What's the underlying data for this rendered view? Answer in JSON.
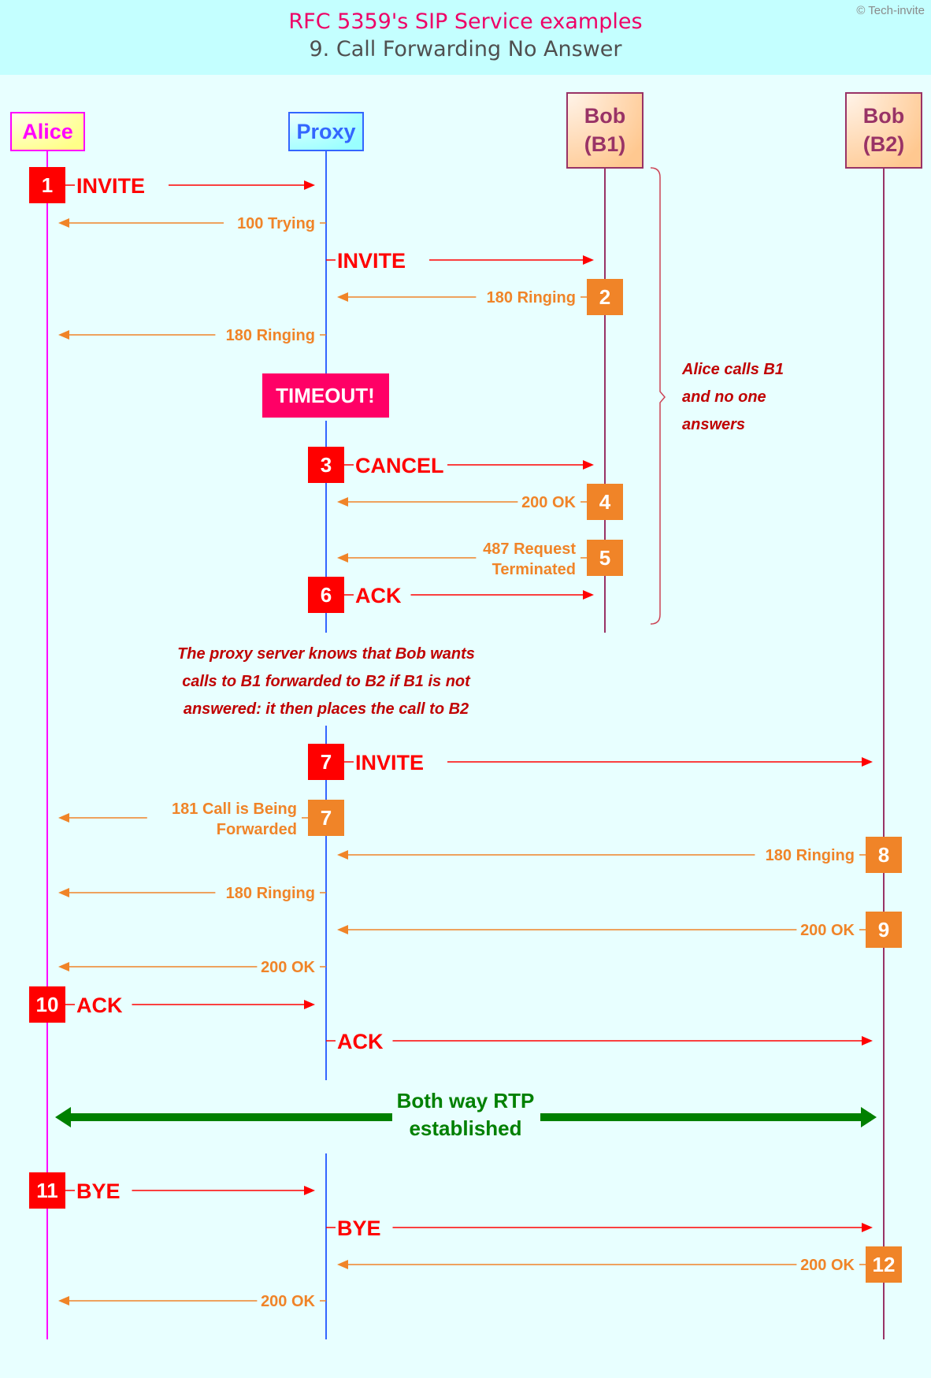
{
  "header": {
    "title": "RFC 5359's SIP Service examples",
    "subtitle": "9. Call Forwarding No Answer",
    "copyright": "© Tech-invite"
  },
  "colors": {
    "header_bg": "#c4ffff",
    "page_bg": "#e8ffff",
    "request": "#ff0000",
    "response": "#f08428",
    "note": "#c00000",
    "rtp": "#008000",
    "timeout_bg": "#ff0066",
    "alice": "#ff00ff",
    "proxy": "#3366ff",
    "bob": "#993366"
  },
  "actors": [
    {
      "id": "alice",
      "lines": [
        "Alice"
      ],
      "color": "#ff00ff",
      "fill": "#ffff99",
      "border": "#ff00ff"
    },
    {
      "id": "proxy",
      "lines": [
        "Proxy"
      ],
      "color": "#3366ff",
      "fill": "#b3ffff",
      "border": "#3366ff"
    },
    {
      "id": "b1",
      "lines": [
        "Bob",
        "(B1)"
      ],
      "color": "#993366",
      "fill": "#ffcc99",
      "border": "#993366"
    },
    {
      "id": "b2",
      "lines": [
        "Bob",
        "(B2)"
      ],
      "color": "#993366",
      "fill": "#ffcc99",
      "border": "#993366"
    }
  ],
  "messages": [
    {
      "from": "alice",
      "to": "proxy",
      "label": [
        "INVITE"
      ],
      "kind": "request",
      "step": "1"
    },
    {
      "from": "proxy",
      "to": "alice",
      "label": [
        "100 Trying"
      ],
      "kind": "response",
      "step": ""
    },
    {
      "from": "proxy",
      "to": "b1",
      "label": [
        "INVITE"
      ],
      "kind": "request",
      "step": ""
    },
    {
      "from": "b1",
      "to": "proxy",
      "label": [
        "180 Ringing"
      ],
      "kind": "response",
      "step": "2"
    },
    {
      "from": "proxy",
      "to": "alice",
      "label": [
        "180 Ringing"
      ],
      "kind": "response",
      "step": ""
    },
    {
      "from": "proxy",
      "to": "b1",
      "label": [
        "CANCEL"
      ],
      "kind": "request",
      "step": "3"
    },
    {
      "from": "b1",
      "to": "proxy",
      "label": [
        "200 OK"
      ],
      "kind": "response",
      "step": "4"
    },
    {
      "from": "b1",
      "to": "proxy",
      "label": [
        "487 Request",
        "Terminated"
      ],
      "kind": "response",
      "step": "5"
    },
    {
      "from": "proxy",
      "to": "b1",
      "label": [
        "ACK"
      ],
      "kind": "request",
      "step": "6"
    },
    {
      "from": "proxy",
      "to": "b2",
      "label": [
        "INVITE"
      ],
      "kind": "request",
      "step": "7"
    },
    {
      "from": "proxy",
      "to": "alice",
      "label": [
        "181 Call is Being",
        "Forwarded"
      ],
      "kind": "response",
      "step": "7"
    },
    {
      "from": "b2",
      "to": "proxy",
      "label": [
        "180 Ringing"
      ],
      "kind": "response",
      "step": "8"
    },
    {
      "from": "proxy",
      "to": "alice",
      "label": [
        "180 Ringing"
      ],
      "kind": "response",
      "step": ""
    },
    {
      "from": "b2",
      "to": "proxy",
      "label": [
        "200 OK"
      ],
      "kind": "response",
      "step": "9"
    },
    {
      "from": "proxy",
      "to": "alice",
      "label": [
        "200 OK"
      ],
      "kind": "response",
      "step": ""
    },
    {
      "from": "alice",
      "to": "proxy",
      "label": [
        "ACK"
      ],
      "kind": "request",
      "step": "10"
    },
    {
      "from": "proxy",
      "to": "b2",
      "label": [
        "ACK"
      ],
      "kind": "request",
      "step": ""
    },
    {
      "from": "alice",
      "to": "proxy",
      "label": [
        "BYE"
      ],
      "kind": "request",
      "step": "11"
    },
    {
      "from": "proxy",
      "to": "b2",
      "label": [
        "BYE"
      ],
      "kind": "request",
      "step": ""
    },
    {
      "from": "b2",
      "to": "proxy",
      "label": [
        "200 OK"
      ],
      "kind": "response",
      "step": "12"
    },
    {
      "from": "proxy",
      "to": "alice",
      "label": [
        "200 OK"
      ],
      "kind": "response",
      "step": ""
    }
  ],
  "timeout": {
    "label": "TIMEOUT!"
  },
  "bracket_note": {
    "lines": [
      "Alice calls B1",
      "and no one",
      "answers"
    ]
  },
  "proxy_note": {
    "lines": [
      "The proxy server knows that Bob wants",
      "calls to B1 forwarded to B2 if B1 is not",
      "answered: it then places the call to B2"
    ]
  },
  "rtp": {
    "lines": [
      "Both way RTP",
      "established"
    ]
  }
}
